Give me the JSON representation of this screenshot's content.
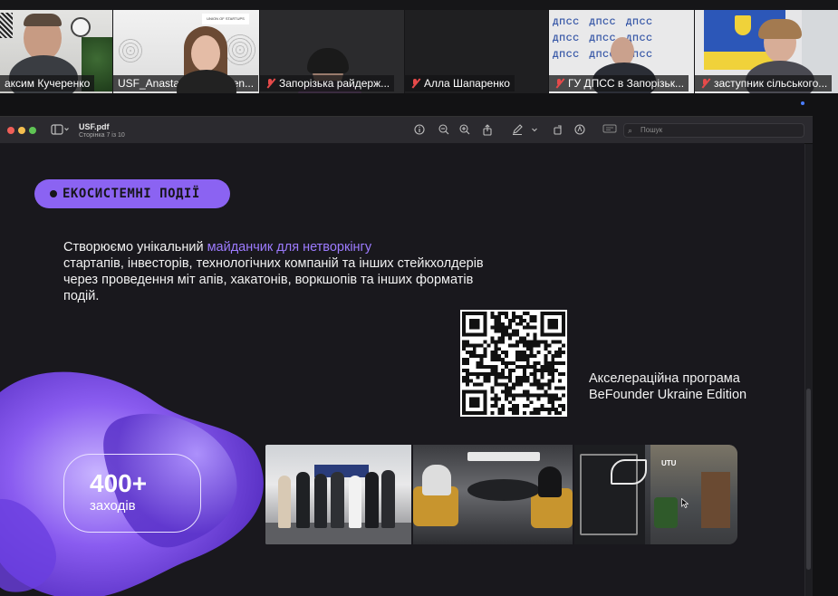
{
  "participants": [
    {
      "name": "аксим Кучеренко",
      "muted": false
    },
    {
      "name": "USF_Anastasiia Kravchen...",
      "muted": false,
      "active": true
    },
    {
      "name": "Запорізька райдерж...",
      "muted": true
    },
    {
      "name": "Алла Шапаренко",
      "muted": true
    },
    {
      "name": "ГУ ДПСС в Запорізьк...",
      "muted": true
    },
    {
      "name": "заступник сільського...",
      "muted": true
    }
  ],
  "backdrop_text": {
    "dpss": "ДПСС",
    "banner": "UNION OF STARTUPS"
  },
  "viewer": {
    "file_name": "USF.pdf",
    "page_info": "Сторінка 7 із 10",
    "search_placeholder": "Пошук",
    "icons": [
      "sidebar-toggle-icon",
      "info-icon",
      "zoom-out-icon",
      "zoom-in-icon",
      "share-icon",
      "markup-icon",
      "rotate-icon",
      "annotate-icon",
      "search-icon"
    ]
  },
  "slide": {
    "pill_label": "ЕКОСИСТЕМНІ ПОДІЇ",
    "body_prefix": "Створюємо унікальний ",
    "body_highlight": "майданчик для нетворкінгу",
    "body_rest": "стартапів, інвесторів, технологічних компаній та інших стейкхолдерів  через проведення  міт апів, хакатонів, воркшопів та інших форматів подій.",
    "accel_text": "Акселераційна програма BeFounder Ukraine Edition",
    "stat_number": "400+",
    "stat_label": "заходів",
    "photo_sign": "UTU",
    "accent_color": "#8b63f2",
    "highlight_color": "#9d7bff"
  }
}
